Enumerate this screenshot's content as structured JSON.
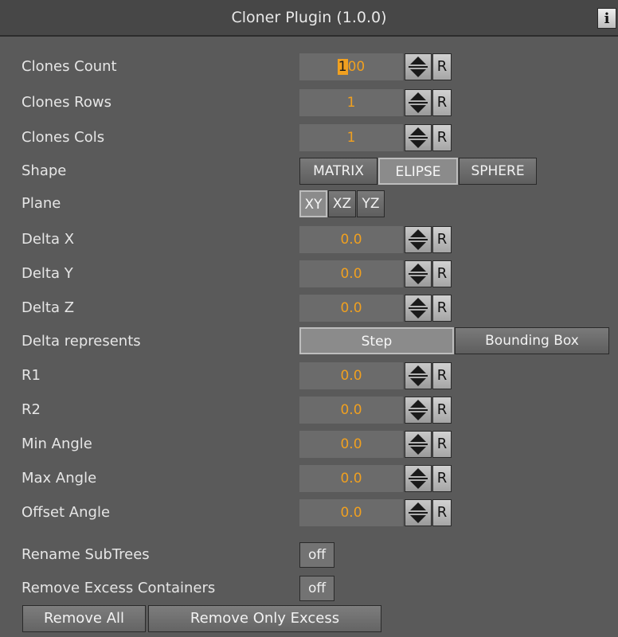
{
  "header": {
    "title": "Cloner Plugin (1.0.0)",
    "info_label": "i"
  },
  "spinner_reset_label": "R",
  "rows": {
    "clones_count": {
      "label": "Clones Count",
      "value_highlight": "1",
      "value_rest": "00"
    },
    "clones_rows": {
      "label": "Clones Rows",
      "value": "1"
    },
    "clones_cols": {
      "label": "Clones Cols",
      "value": "1"
    },
    "shape": {
      "label": "Shape",
      "options": [
        "MATRIX",
        "ELIPSE",
        "SPHERE"
      ],
      "selected": "ELIPSE"
    },
    "plane": {
      "label": "Plane",
      "options": [
        "XY",
        "XZ",
        "YZ"
      ],
      "selected": "XY"
    },
    "delta_x": {
      "label": "Delta X",
      "value": "0.0"
    },
    "delta_y": {
      "label": "Delta Y",
      "value": "0.0"
    },
    "delta_z": {
      "label": "Delta Z",
      "value": "0.0"
    },
    "delta_represents": {
      "label": "Delta represents",
      "options": [
        "Step",
        "Bounding Box"
      ],
      "selected": "Step"
    },
    "r1": {
      "label": "R1",
      "value": "0.0"
    },
    "r2": {
      "label": "R2",
      "value": "0.0"
    },
    "min_angle": {
      "label": "Min Angle",
      "value": "0.0"
    },
    "max_angle": {
      "label": "Max Angle",
      "value": "0.0"
    },
    "offset_angle": {
      "label": "Offset Angle",
      "value": "0.0"
    },
    "rename_subtrees": {
      "label": "Rename SubTrees",
      "value": "off"
    },
    "remove_excess_containers": {
      "label": "Remove Excess Containers",
      "value": "off"
    }
  },
  "actions": {
    "remove_all": "Remove All",
    "remove_only_excess": "Remove Only Excess"
  },
  "colors": {
    "background": "#5a5a5a",
    "value_text": "#f0a020",
    "field_bg": "#6b6b6b"
  }
}
